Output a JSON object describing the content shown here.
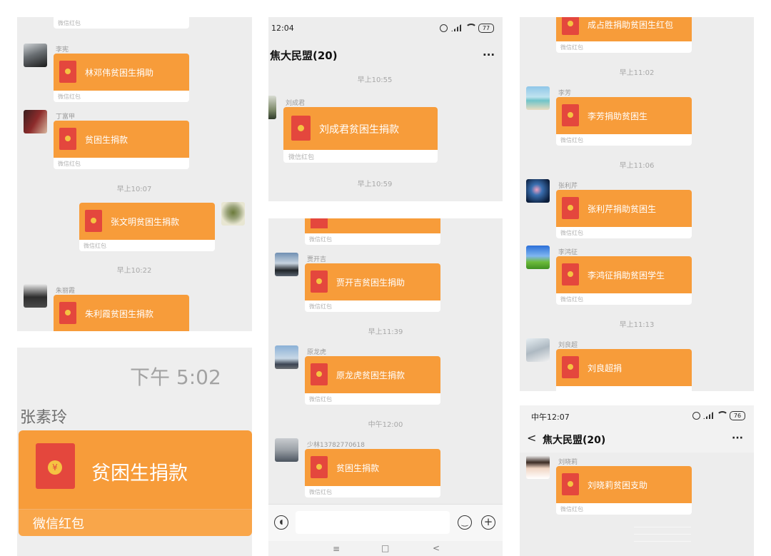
{
  "envelope_sub": "微信红包",
  "colors": {
    "orange": "#f79c3a",
    "envelope_red": "#e4473d",
    "panel_bg": "#ededed"
  },
  "panel_a": {
    "top_envelope_sub": "微信红包",
    "msgs": [
      {
        "sender": "李宪",
        "title": "林邓伟贫困生捐助"
      },
      {
        "sender": "丁富甲",
        "title": "贫困生捐款"
      },
      {
        "time": "早上10:07"
      },
      {
        "title": "张文明贫困生捐款"
      },
      {
        "time": "早上10:22"
      },
      {
        "sender": "朱丽霞",
        "title": "朱利霞贫困生捐款"
      }
    ]
  },
  "panel_b": {
    "status_time": "12:04",
    "battery": "77",
    "chat_title": "焦大民盟(20)",
    "more": "···",
    "time1": "早上10:55",
    "sender": "刘成君",
    "title": "刘成君贫困生捐款",
    "time2": "早上10:59"
  },
  "panel_c": {
    "msgs": [
      {
        "sender": "贾开吉",
        "title": "贾开吉贫困生捐助"
      },
      {
        "time": "早上11:39"
      },
      {
        "sender": "原龙虎",
        "title": "原龙虎贫困生捐款"
      },
      {
        "time": "中午12:00"
      },
      {
        "sender": "少林13782770618",
        "title": "贫困生捐款"
      }
    ]
  },
  "panel_d": {
    "top_title": "成占胜捐助贫困生红包",
    "time1": "早上11:02",
    "m1": {
      "sender": "李芳",
      "title": "李芳捐助贫困生"
    },
    "time2": "早上11:06",
    "m2": {
      "sender": "张利芹",
      "title": "张利芹捐助贫困生"
    },
    "m3": {
      "sender": "李鸿征",
      "title": "李鸿征捐助贫困学生"
    },
    "time3": "早上11:13",
    "m4": {
      "sender": "刘良超",
      "title": "刘良超捐"
    }
  },
  "panel_e": {
    "status_time": "中午12:07",
    "battery": "76",
    "chat_title": "焦大民盟(20)",
    "more": "···",
    "sender": "刘晓莉",
    "title": "刘晓莉贫困支助"
  },
  "panel_f": {
    "time": "下午 5:02",
    "sender": "张素玲",
    "title": "贫困生捐款",
    "sub": "微信红包"
  },
  "nav": {
    "recents": "≡",
    "home": "□",
    "back": "<"
  }
}
